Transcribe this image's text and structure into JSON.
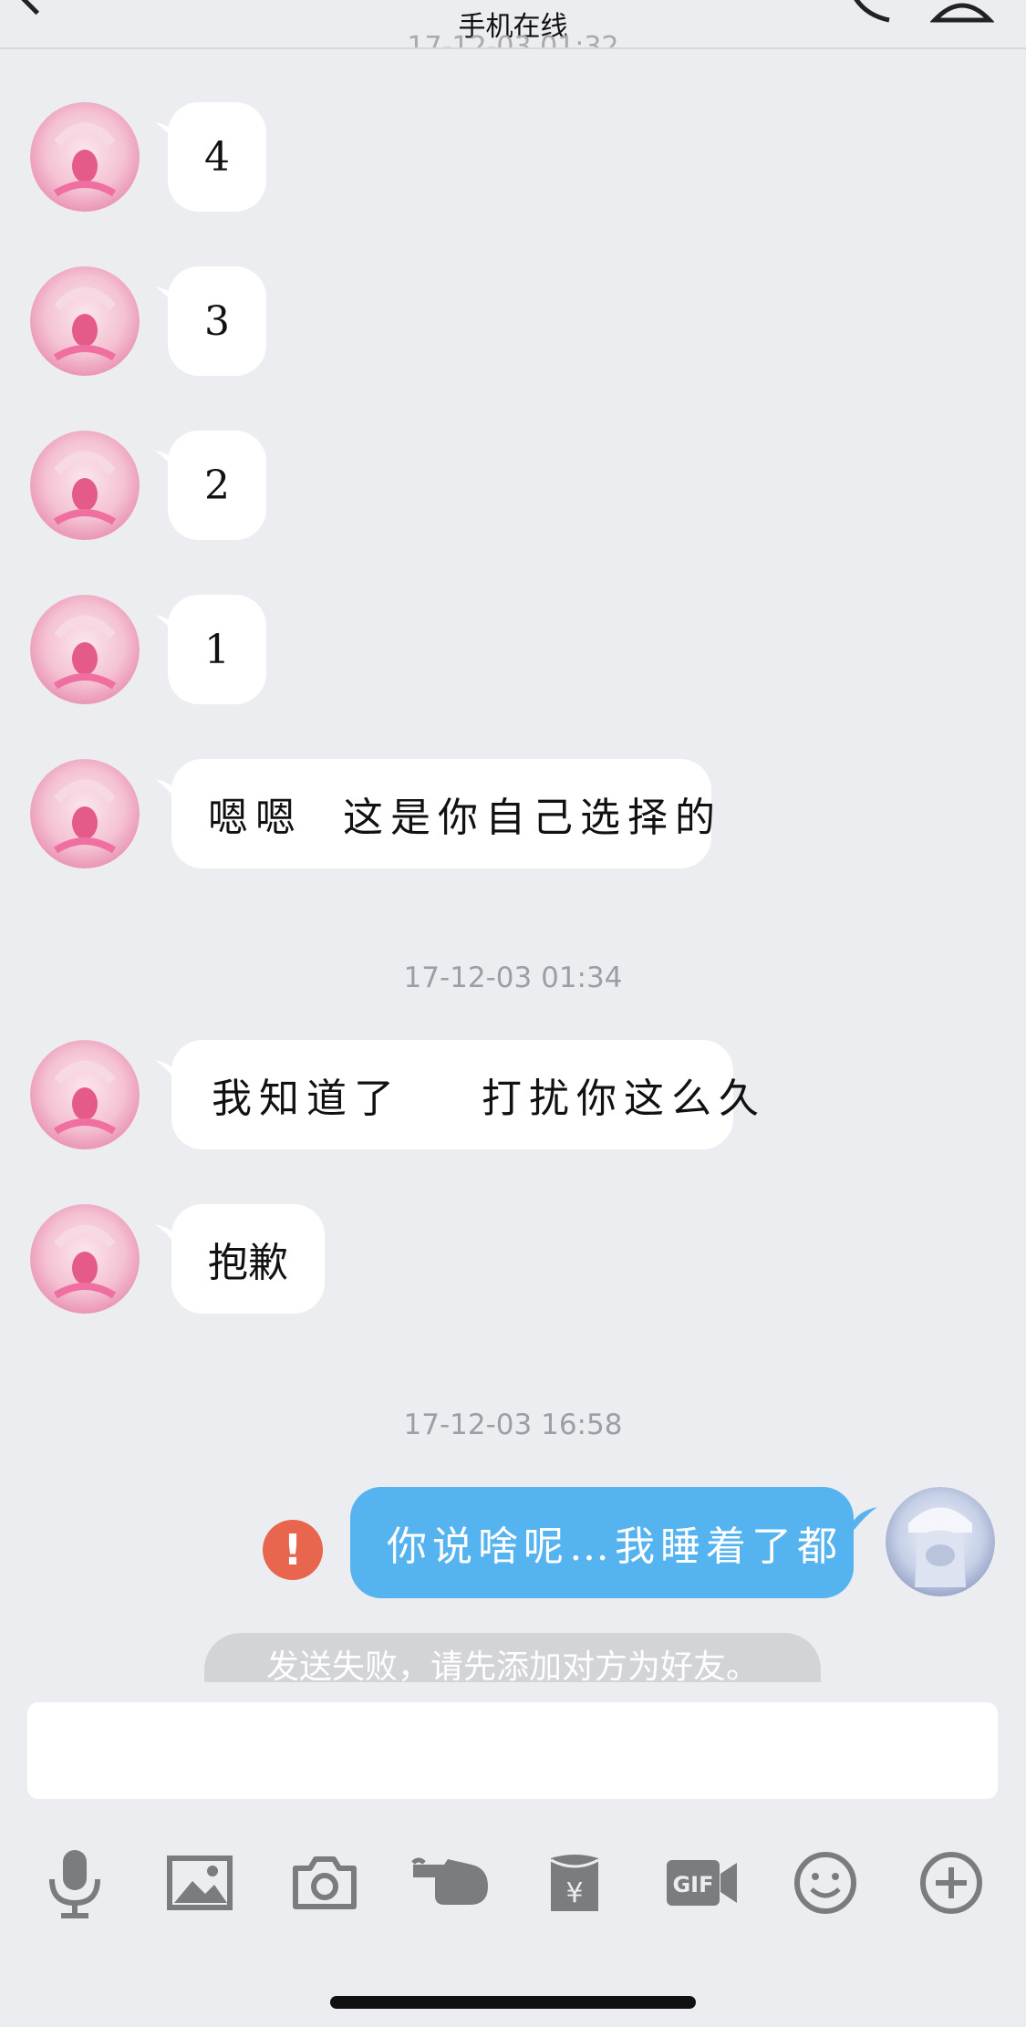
{
  "header": {
    "status": "手机在线",
    "partial_timestamp": "17-12-03 01:32"
  },
  "colors": {
    "background": "#ecedf1",
    "bubble_in": "#ffffff",
    "bubble_out": "#55b3f0",
    "error": "#e8654e"
  },
  "messages": [
    {
      "text": "4"
    },
    {
      "text": "3"
    },
    {
      "text": "2"
    },
    {
      "text": "1"
    },
    {
      "text": "嗯嗯  这是你自己选择的"
    },
    {
      "text": "我知道了    打扰你这么久"
    },
    {
      "text": "抱歉"
    }
  ],
  "timestamps": [
    "17-12-03 01:34",
    "17-12-03 16:58"
  ],
  "outgoing": {
    "text": "你说啥呢…我睡着了都",
    "error_icon": "!"
  },
  "notice": "发送失败，请先添加对方为好友。",
  "toolbar": [
    {
      "icon": "microphone-icon"
    },
    {
      "icon": "image-icon"
    },
    {
      "icon": "camera-icon"
    },
    {
      "icon": "poke-hand-icon"
    },
    {
      "icon": "red-packet-icon"
    },
    {
      "icon": "gif-icon"
    },
    {
      "icon": "emoji-icon"
    },
    {
      "icon": "plus-icon"
    }
  ]
}
